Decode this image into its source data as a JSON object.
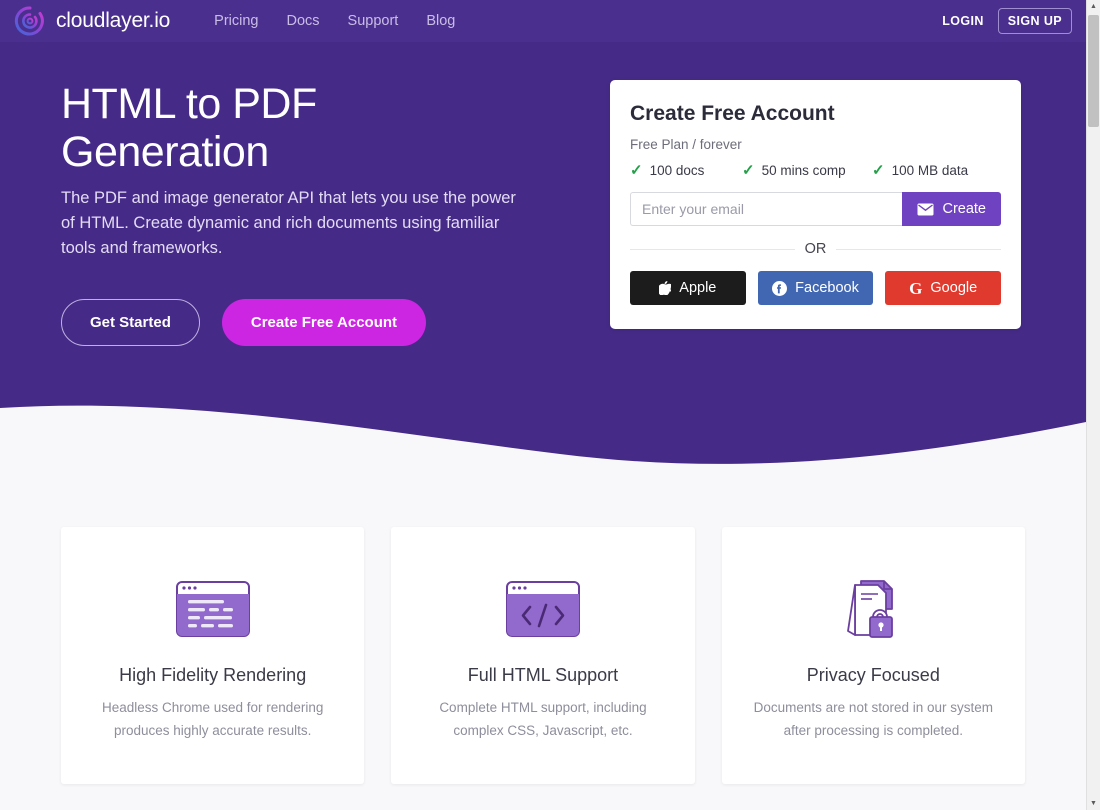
{
  "navbar": {
    "logo_icon": "cloudlayer-circle-logo",
    "brand": "cloudlayer.io",
    "links": [
      {
        "label": "Pricing"
      },
      {
        "label": "Docs"
      },
      {
        "label": "Support"
      },
      {
        "label": "Blog"
      }
    ],
    "login_label": "LOGIN",
    "signup_label": "SIGN UP"
  },
  "hero": {
    "title": "HTML to PDF Generation",
    "subtitle": "The PDF and image generator API that lets you use the power of HTML. Create dynamic and rich documents using familiar tools and frameworks.",
    "primary_button": "Get Started",
    "secondary_button": "Create Free Account",
    "background_color": "#452a87",
    "accent_color": "#cc26e3"
  },
  "signup_card": {
    "title": "Create Free Account",
    "plan_label": "Free Plan / forever",
    "check_icon": "check-icon",
    "check_color": "#22a148",
    "features": [
      {
        "label": "100 docs"
      },
      {
        "label": "50 mins comp"
      },
      {
        "label": "100 MB data"
      }
    ],
    "email_placeholder": "Enter your email",
    "email_value": "",
    "create_button": "Create",
    "create_icon": "envelope-icon",
    "create_color": "#6f42c1",
    "divider_text": "OR",
    "social_buttons": [
      {
        "label": "Apple",
        "icon": "apple-icon",
        "glyph": "",
        "color": "#1c1c1c"
      },
      {
        "label": "Facebook",
        "icon": "facebook-icon",
        "glyph": "f",
        "color": "#4267b2"
      },
      {
        "label": "Google",
        "icon": "google-icon",
        "glyph": "G",
        "color": "#e0392e"
      }
    ]
  },
  "features": [
    {
      "icon": "browser-text-lines-icon",
      "title": "High Fidelity Rendering",
      "description": "Headless Chrome used for rendering produces highly accurate results."
    },
    {
      "icon": "browser-code-brackets-icon",
      "title": "Full HTML Support",
      "description": "Complete HTML support, including complex CSS, Javascript, etc."
    },
    {
      "icon": "document-lock-icon",
      "title": "Privacy Focused",
      "description": "Documents are not stored in our system after processing is completed."
    }
  ],
  "scrollbar": {
    "up_arrow": "▲",
    "down_arrow": "▼"
  }
}
